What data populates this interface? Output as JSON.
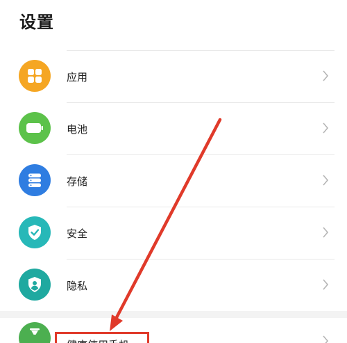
{
  "header": {
    "title": "设置"
  },
  "settings": {
    "items": [
      {
        "label": "应用",
        "icon": "apps-grid-icon",
        "color": "#f5a623"
      },
      {
        "label": "电池",
        "icon": "battery-icon",
        "color": "#5cc24a"
      },
      {
        "label": "存储",
        "icon": "storage-icon",
        "color": "#2f7de1"
      },
      {
        "label": "安全",
        "icon": "shield-check-icon",
        "color": "#27b8b8"
      },
      {
        "label": "隐私",
        "icon": "privacy-shield-icon",
        "color": "#1fa9a0"
      }
    ],
    "partial_item": {
      "label": "健康使用手机",
      "icon": "hourglass-icon",
      "color": "#4caf50"
    }
  },
  "annotation": {
    "arrow_color": "#e03a2a",
    "highlight_color": "#e03a2a"
  }
}
